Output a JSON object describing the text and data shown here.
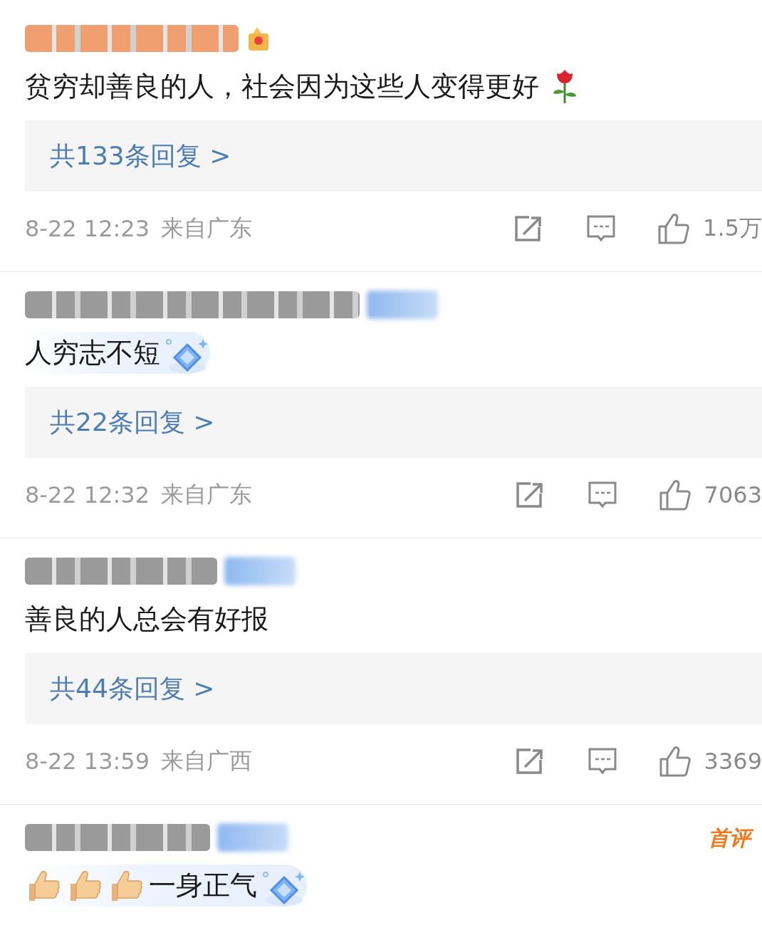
{
  "comments": [
    {
      "color": "#f0a070",
      "badge": {
        "kind": "crown"
      },
      "bubble": false,
      "text": "贫穷却善良的人，社会因为这些人变得更好",
      "emoji": {
        "kind": "rose"
      },
      "replies": "共133条回复 >",
      "time": "8-22 12:23",
      "location": "来自广东",
      "likes": "1.5万"
    },
    {
      "color": "#9a9a9a",
      "badge": {
        "kind": "vip"
      },
      "bubble": true,
      "text": "人穷志不短",
      "replies": "共22条回复 >",
      "time": "8-22 12:32",
      "location": "来自广东",
      "likes": "7063"
    },
    {
      "color": "#9a9a9a",
      "badge": {
        "kind": "vip"
      },
      "bubble": false,
      "text": "善良的人总会有好报",
      "replies": "共44条回复 >",
      "time": "8-22 13:59",
      "location": "来自广西",
      "likes": "3369"
    },
    {
      "color": "#9a9a9a",
      "badge": {
        "kind": "vip"
      },
      "bubble": true,
      "tag": "首评",
      "leading_emojis": [
        {
          "kind": "thumbs-up"
        },
        {
          "kind": "thumbs-up"
        },
        {
          "kind": "thumbs-up"
        }
      ],
      "text": "一身正气"
    }
  ]
}
